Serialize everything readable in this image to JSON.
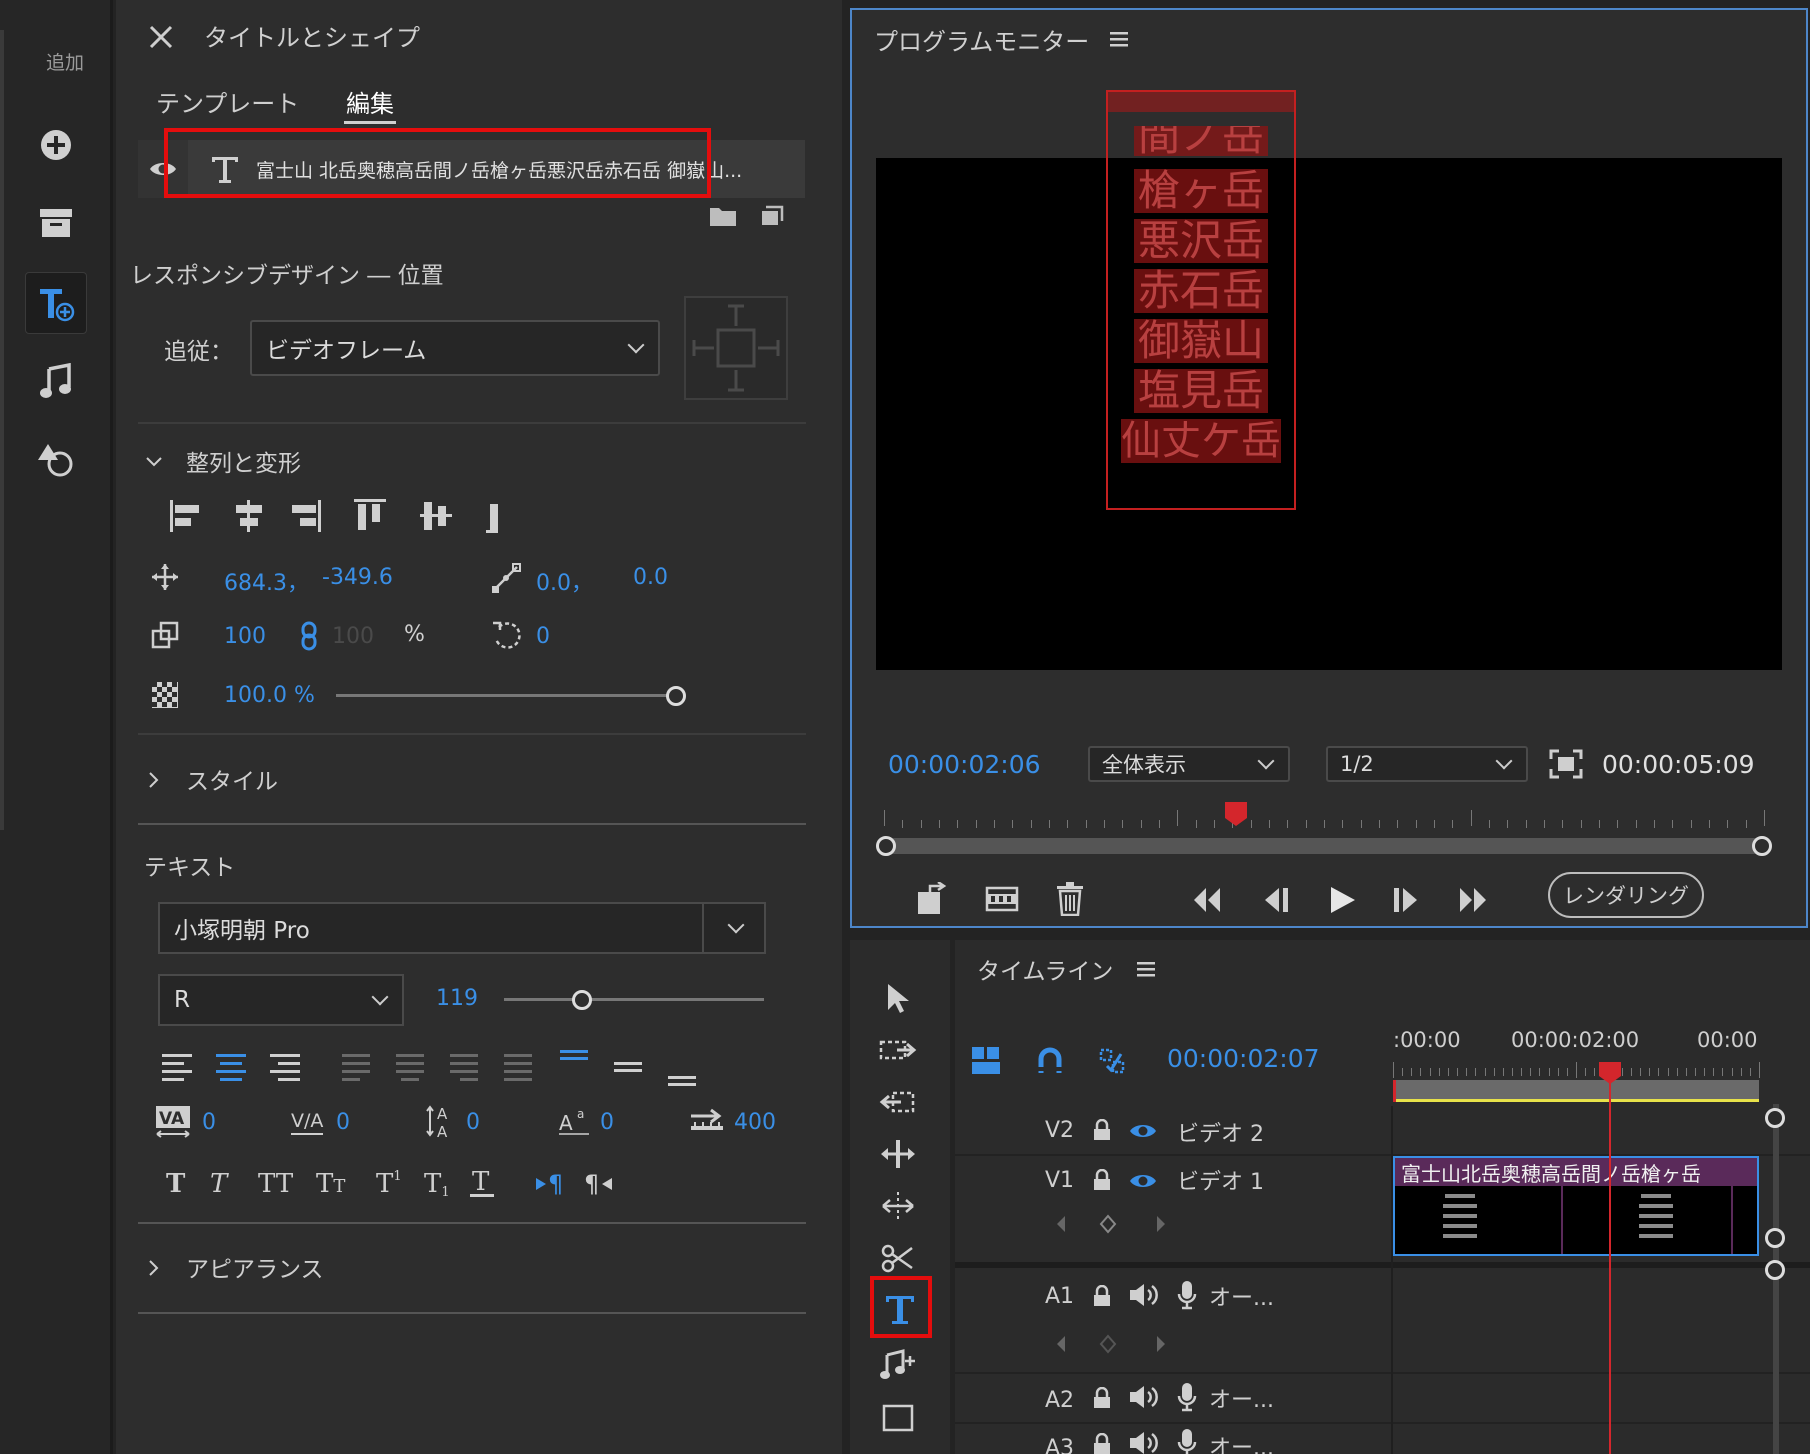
{
  "colors": {
    "accent": "#3a8fe6",
    "highlight": "#e40d0d",
    "panel_border": "#4d86c9",
    "clip": "#5a2a5a",
    "playhead": "#d4262c"
  },
  "rail": {
    "label": "追加",
    "icons": [
      "plus-circle-icon",
      "archive-icon",
      "add-text-icon",
      "music-note-icon",
      "replace-shape-icon"
    ]
  },
  "ts": {
    "title": "タイトルとシェイプ",
    "tabs": [
      "テンプレート",
      "編集"
    ],
    "layer_text": "富士山 北岳奥穂高岳間ノ岳槍ヶ岳悪沢岳赤石岳 御嶽山...",
    "responsive_label": "レスポンシブデザイン ― 位置",
    "follow_label": "追従：",
    "follow_value": "ビデオフレーム",
    "align_section": "整列と変形",
    "pos_x": "684.3，",
    "pos_y": "-349.6",
    "anchor_x": "0.0，",
    "anchor_y": "0.0",
    "scale": "100",
    "scale_linked": "100",
    "scale_unit": "%",
    "rotation": "0",
    "opacity": "100.0 %",
    "opacity_level": 1.0,
    "style_section": "スタイル",
    "text_section": "テキスト",
    "font": "小塚明朝 Pro",
    "font_style": "R",
    "font_size": "119",
    "font_size_level": 0.3,
    "kerning": "0",
    "tracking": "0",
    "leading": "0",
    "baseline": "0",
    "tab_width": "400",
    "appearance_section": "アピアランス"
  },
  "pm": {
    "title": "プログラムモニター",
    "overlay_lines": [
      "間ノ岳",
      "槍ヶ岳",
      "悪沢岳",
      "赤石岳",
      "御嶽山",
      "塩見岳",
      "仙丈ケ岳"
    ],
    "timecode": "00:00:02:06",
    "zoom": "全体表示",
    "resolution": "1/2",
    "duration": "00:00:05:09",
    "render_label": "レンダリング",
    "playhead_pos": 0.4
  },
  "tl": {
    "title": "タイムライン",
    "timecode": "00:00:02:07",
    "ruler_labels": [
      ":00:00",
      "00:00:02:00",
      "00:00"
    ],
    "tracks": [
      {
        "id": "V2",
        "name": "ビデオ 2"
      },
      {
        "id": "V1",
        "name": "ビデオ 1"
      },
      {
        "id": "A1",
        "name": "オー..."
      },
      {
        "id": "A2",
        "name": "オー..."
      },
      {
        "id": "A3",
        "name": "オー..."
      }
    ],
    "clip_title": "富士山北岳奥穂高岳間ノ岳槍ヶ岳"
  }
}
